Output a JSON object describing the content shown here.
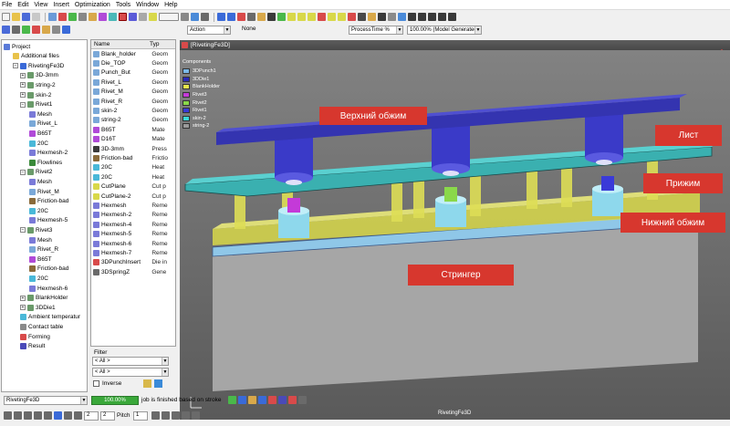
{
  "menu": [
    "File",
    "Edit",
    "View",
    "Insert",
    "Optimization",
    "Tools",
    "Window",
    "Help"
  ],
  "toolbar": {
    "action_label": "Action",
    "none_label": "None",
    "process_combo": "ProcessTime %",
    "model_combo": "100.00% (Model Generated"
  },
  "tree": {
    "items": [
      {
        "label": "Project",
        "icon": "project-icon"
      },
      {
        "label": "Additional files",
        "icon": "folder-icon"
      },
      {
        "label": "RivetingFe3D",
        "icon": "model-icon"
      },
      {
        "label": "3D-3mm",
        "icon": "part-icon"
      },
      {
        "label": "string-2",
        "icon": "part-icon"
      },
      {
        "label": "skin-2",
        "icon": "part-icon"
      },
      {
        "label": "Rivet1",
        "icon": "part-icon"
      },
      {
        "label": "Mesh",
        "icon": "mesh-icon"
      },
      {
        "label": "Rivet_L",
        "icon": "geometry-icon"
      },
      {
        "label": "B65T",
        "icon": "material-icon"
      },
      {
        "label": "20C",
        "icon": "temperature-icon"
      },
      {
        "label": "Hexmesh-2",
        "icon": "mesh-icon"
      },
      {
        "label": "Flowlines",
        "icon": "flowlines-icon"
      },
      {
        "label": "Rivet2",
        "icon": "part-icon"
      },
      {
        "label": "Mesh",
        "icon": "mesh-icon"
      },
      {
        "label": "Rivet_M",
        "icon": "geometry-icon"
      },
      {
        "label": "Friction-bad",
        "icon": "friction-icon"
      },
      {
        "label": "20C",
        "icon": "temperature-icon"
      },
      {
        "label": "Hexmesh-5",
        "icon": "mesh-icon"
      },
      {
        "label": "Rivet3",
        "icon": "part-icon"
      },
      {
        "label": "Mesh",
        "icon": "mesh-icon"
      },
      {
        "label": "Rivet_R",
        "icon": "geometry-icon"
      },
      {
        "label": "B65T",
        "icon": "material-icon"
      },
      {
        "label": "Friction-bad",
        "icon": "friction-icon"
      },
      {
        "label": "20C",
        "icon": "temperature-icon"
      },
      {
        "label": "Hexmesh-6",
        "icon": "mesh-icon"
      },
      {
        "label": "BlankHolder",
        "icon": "part-icon"
      },
      {
        "label": "3DDie1",
        "icon": "part-icon"
      },
      {
        "label": "Ambient temperatur",
        "icon": "temperature-icon"
      },
      {
        "label": "Contact table",
        "icon": "table-icon"
      },
      {
        "label": "Forming",
        "icon": "forming-icon"
      },
      {
        "label": "Result",
        "icon": "result-icon"
      }
    ]
  },
  "list": {
    "header_name": "Name",
    "header_type": "Typ",
    "rows": [
      {
        "name": "Blank_holder",
        "type": "Geom",
        "icon": "geometry-icon"
      },
      {
        "name": "Die_TOP",
        "type": "Geom",
        "icon": "geometry-icon"
      },
      {
        "name": "Punch_But",
        "type": "Geom",
        "icon": "geometry-icon"
      },
      {
        "name": "Rivet_L",
        "type": "Geom",
        "icon": "geometry-icon"
      },
      {
        "name": "Rivet_M",
        "type": "Geom",
        "icon": "geometry-icon"
      },
      {
        "name": "Rivet_R",
        "type": "Geom",
        "icon": "geometry-icon"
      },
      {
        "name": "skin-2",
        "type": "Geom",
        "icon": "geometry-icon"
      },
      {
        "name": "string-2",
        "type": "Geom",
        "icon": "geometry-icon"
      },
      {
        "name": "B65T",
        "type": "Mate",
        "icon": "material-icon"
      },
      {
        "name": "D16T",
        "type": "Mate",
        "icon": "material-icon"
      },
      {
        "name": "3D-3mm",
        "type": "Press",
        "icon": "press-icon"
      },
      {
        "name": "Friction-bad",
        "type": "Frictio",
        "icon": "friction-icon"
      },
      {
        "name": "20C",
        "type": "Heat",
        "icon": "temperature-icon"
      },
      {
        "name": "20C",
        "type": "Heat",
        "icon": "temperature-icon"
      },
      {
        "name": "CutPlane",
        "type": "Cut p",
        "icon": "cutplane-icon"
      },
      {
        "name": "CutPlane-2",
        "type": "Cut p",
        "icon": "cutplane-icon"
      },
      {
        "name": "Hexmesh",
        "type": "Reme",
        "icon": "mesh-icon"
      },
      {
        "name": "Hexmesh-2",
        "type": "Reme",
        "icon": "mesh-icon"
      },
      {
        "name": "Hexmesh-4",
        "type": "Reme",
        "icon": "mesh-icon"
      },
      {
        "name": "Hexmesh-5",
        "type": "Reme",
        "icon": "mesh-icon"
      },
      {
        "name": "Hexmesh-6",
        "type": "Reme",
        "icon": "mesh-icon"
      },
      {
        "name": "Hexmesh-7",
        "type": "Reme",
        "icon": "mesh-icon"
      },
      {
        "name": "3DPunchInsert",
        "type": "Die in",
        "icon": "die-icon"
      },
      {
        "name": "3DSpringZ",
        "type": "Gene",
        "icon": "spring-icon"
      }
    ],
    "filter_label": "Filter",
    "filter_value_1": "< All >",
    "filter_value_2": "< All >",
    "inverse_label": "Inverse"
  },
  "viewport": {
    "title": "[RivetingFe3D]",
    "components_label": "Components",
    "legend": [
      {
        "name": "3DPunch1",
        "color": "#7ab8e8"
      },
      {
        "name": "3DDie1",
        "color": "#2a2ab8"
      },
      {
        "name": "BlankHolder",
        "color": "#e6e64a"
      },
      {
        "name": "Rivet3",
        "color": "#c43ad8"
      },
      {
        "name": "Rivet2",
        "color": "#8ad84a"
      },
      {
        "name": "Rivet1",
        "color": "#3a3ad8"
      },
      {
        "name": "skin-2",
        "color": "#3ad8d8"
      },
      {
        "name": "string-2",
        "color": "#9a9a9a"
      }
    ],
    "labels": {
      "upper": "Верхний обжим",
      "sheet": "Лист",
      "clamp": "Прижим",
      "lower": "Нижний обжим",
      "stringer": "Стрингер"
    },
    "footer": "RivetingFe3D"
  },
  "status": {
    "model_combo": "RivetingFe3D",
    "progress_percent": 100,
    "progress_text": "100.00%",
    "message": "job is finished based on stroke"
  },
  "bottom": {
    "value1": "2",
    "value2": "2",
    "pitch_label": "Pitch",
    "pitch_value": "1"
  },
  "colors": {
    "label_red": "#d7372e",
    "upper_die": "#3434b0",
    "sheet": "#3ab0b0",
    "clamp": "#d8d84a",
    "stringer": "#a0a0a0"
  }
}
